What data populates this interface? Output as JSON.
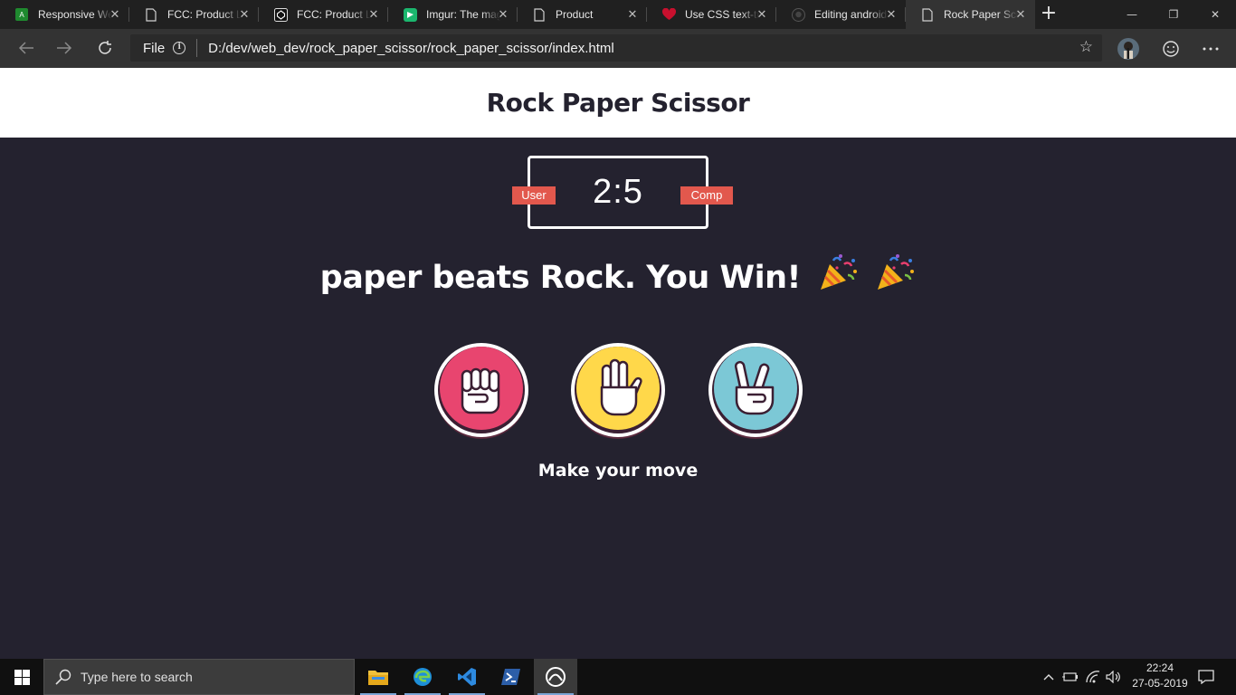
{
  "browser": {
    "tabs": [
      {
        "title": "Responsive Web",
        "favicon": "a11y-green-icon"
      },
      {
        "title": "FCC: Product Landing",
        "favicon": "page-icon"
      },
      {
        "title": "FCC: Product Landing",
        "favicon": "codepen-icon"
      },
      {
        "title": "Imgur: The magic",
        "favicon": "imgur-icon"
      },
      {
        "title": "Product",
        "favicon": "page-icon"
      },
      {
        "title": "Use CSS text-transform",
        "favicon": "heart-icon"
      },
      {
        "title": "Editing android",
        "favicon": "github-icon"
      },
      {
        "title": "Rock Paper Scissor",
        "favicon": "page-icon",
        "active": true
      }
    ],
    "address": {
      "scheme": "File",
      "url": "D:/dev/web_dev/rock_paper_scissor/rock_paper_scissor/index.html"
    }
  },
  "page": {
    "title": "Rock Paper Scissor",
    "score": {
      "user_label": "User",
      "comp_label": "Comp",
      "value": "2:5"
    },
    "result": "paper beats Rock. You Win!",
    "result_emoji": "party-popper-icon",
    "choices": [
      {
        "name": "rock",
        "color": "#e8456f"
      },
      {
        "name": "paper",
        "color": "#ffd84a"
      },
      {
        "name": "scissor",
        "color": "#7cc8d6"
      }
    ],
    "prompt": "Make your move"
  },
  "colors": {
    "page_bg": "#24222f",
    "badge": "#e2584d",
    "header_bg": "#ffffff"
  },
  "taskbar": {
    "search_placeholder": "Type here to search",
    "time": "22:24",
    "date": "27-05-2019"
  }
}
